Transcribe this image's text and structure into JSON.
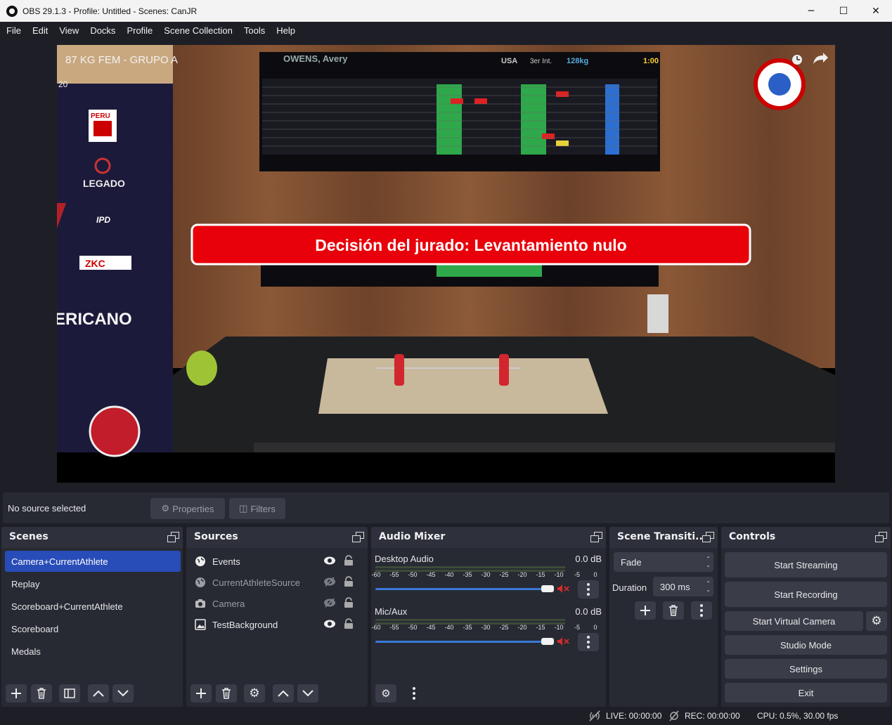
{
  "window": {
    "title": "OBS 29.1.3 - Profile: Untitled - Scenes: CanJR",
    "minimize": "─",
    "maximize": "☐",
    "close": "✕"
  },
  "menu": [
    "File",
    "Edit",
    "View",
    "Docks",
    "Profile",
    "Scene Collection",
    "Tools",
    "Help"
  ],
  "preview": {
    "overlay_title": "87 KG FEM - GRUPO A",
    "banner_text": "Decisión del jurado: Levantamiento nulo",
    "scoreboard_name": "OWENS, Avery",
    "scoreboard_country": "USA",
    "scoreboard_attempt": "3er Int.",
    "scoreboard_weight": "128kg",
    "scoreboard_timer": "1:00",
    "sponsor_peru": "PERU",
    "sponsor_legado": "LEGADO",
    "sponsor_ipd": "IPD",
    "sponsor_zkc": "ZKC",
    "wall_text": "ERICANO",
    "top_left_text": "20"
  },
  "source_bar": {
    "status": "No source selected",
    "properties": "Properties",
    "filters": "Filters"
  },
  "scenes": {
    "title": "Scenes",
    "items": [
      "Camera+CurrentAthlete",
      "Replay",
      "Scoreboard+CurrentAthlete",
      "Scoreboard",
      "Medals"
    ],
    "selected_index": 0
  },
  "sources": {
    "title": "Sources",
    "items": [
      {
        "name": "Events",
        "type": "browser",
        "visible": true
      },
      {
        "name": "CurrentAthleteSource",
        "type": "browser",
        "visible": false
      },
      {
        "name": "Camera",
        "type": "camera",
        "visible": false
      },
      {
        "name": "TestBackground",
        "type": "image",
        "visible": true
      }
    ]
  },
  "audio_mixer": {
    "title": "Audio Mixer",
    "channels": [
      {
        "name": "Desktop Audio",
        "db": "0.0 dB",
        "muted": true,
        "volume": 1.0
      },
      {
        "name": "Mic/Aux",
        "db": "0.0 dB",
        "muted": true,
        "volume": 1.0
      }
    ],
    "ticks": [
      "-60",
      "-55",
      "-50",
      "-45",
      "-40",
      "-35",
      "-30",
      "-25",
      "-20",
      "-15",
      "-10",
      "-5",
      "0"
    ]
  },
  "transitions": {
    "title": "Scene Transiti...",
    "selected": "Fade",
    "duration_label": "Duration",
    "duration_value": "300 ms"
  },
  "controls": {
    "title": "Controls",
    "start_streaming": "Start Streaming",
    "start_recording": "Start Recording",
    "start_virtual_camera": "Start Virtual Camera",
    "studio_mode": "Studio Mode",
    "settings": "Settings",
    "exit": "Exit"
  },
  "status": {
    "live": "LIVE: 00:00:00",
    "rec": "REC: 00:00:00",
    "cpu": "CPU: 0.5%, 30.00 fps"
  },
  "colors": {
    "accent": "#284cb8",
    "banner": "#e8000a",
    "meter_blue": "#3a78d6",
    "mute_red": "#d62b2b"
  }
}
